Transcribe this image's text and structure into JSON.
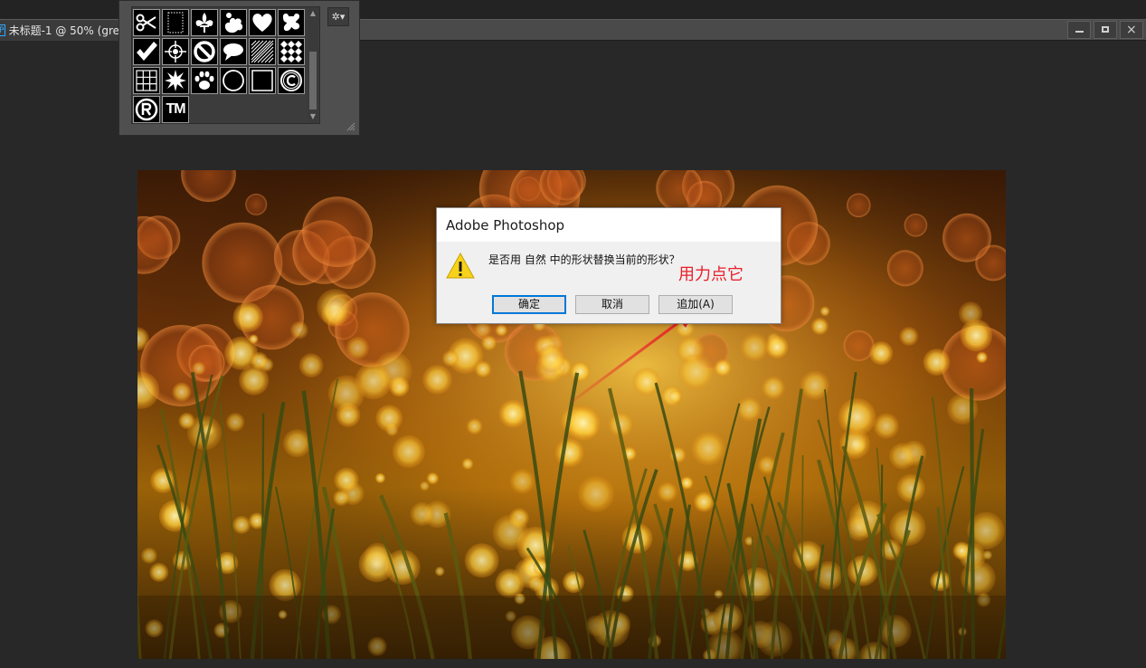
{
  "document_tab": {
    "app_badge": "Ps",
    "title": "未标题-1 @ 50% (gre"
  },
  "window_controls": {
    "minimize": "minimize-icon",
    "maximize": "maximize-icon",
    "close_glyph": "×"
  },
  "shape_picker": {
    "shapes": [
      "scissors-shape",
      "frame-shape",
      "fleur-de-lis-shape",
      "flower-blot-shape",
      "heart-shape",
      "puzzle-shape",
      "checkmark-shape",
      "target-shape",
      "no-sign-shape",
      "speech-bubble-shape",
      "diagonal-lines-shape",
      "checker-shape",
      "grid-shape",
      "starburst-shape",
      "paw-print-shape",
      "circle-frame-shape",
      "square-shape",
      "copyright-shape",
      "registered-shape",
      "trademark-shape"
    ],
    "trademark_text": "TM",
    "gear_glyph": "✲▾"
  },
  "dialog": {
    "title": "Adobe Photoshop",
    "message": "是否用 自然 中的形状替换当前的形状？",
    "buttons": {
      "ok": "确定",
      "cancel": "取消",
      "append": "追加(A)"
    }
  },
  "annotation": {
    "text": "用力点它",
    "color": "#e8202a"
  },
  "colors": {
    "workspace": "#282828",
    "panel": "#4f4f4f",
    "accent_blue": "#0078d7",
    "warning_yellow": "#f7d21a"
  }
}
